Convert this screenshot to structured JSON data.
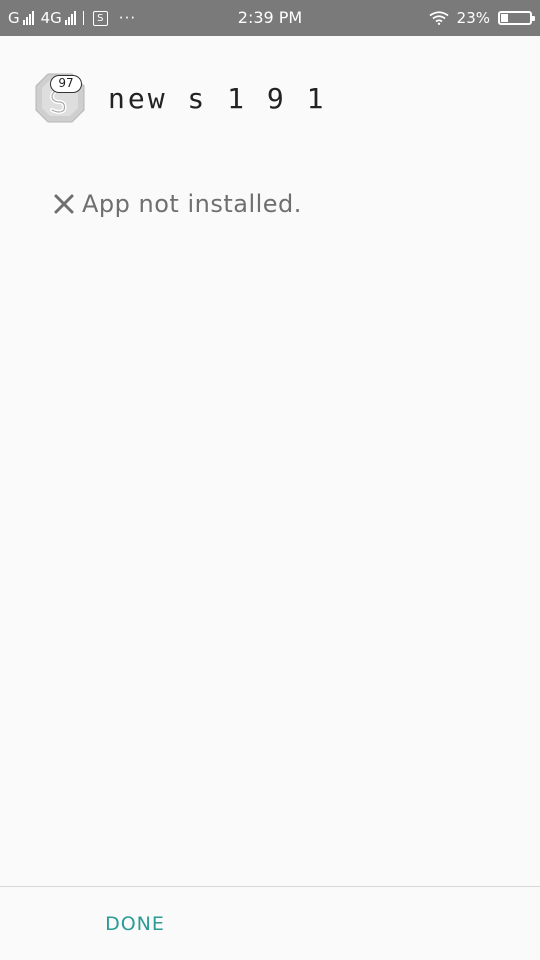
{
  "status_bar": {
    "sim1": "G",
    "sim2": "4G",
    "sim_icon": "S",
    "more": "···",
    "time": "2:39 PM",
    "battery_percent": "23%",
    "battery_level": 0.23,
    "wifi_icon": "wifi-icon",
    "color": "#7a7a7a"
  },
  "app": {
    "name": "new s 1 9 1",
    "badge": "97",
    "icon": "app-icon"
  },
  "install": {
    "icon": "close-icon",
    "message": "App not installed."
  },
  "footer": {
    "done_label": "DONE",
    "accent": "#2b9b96"
  }
}
